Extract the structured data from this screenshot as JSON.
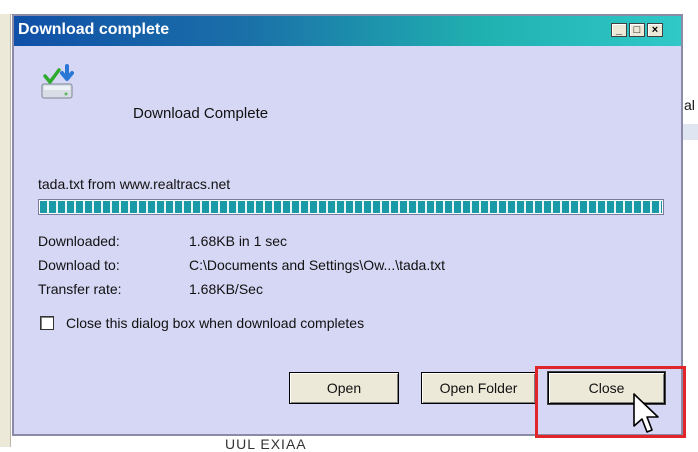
{
  "dialog": {
    "title": "Download complete",
    "header": "Download Complete",
    "file_line": "tada.txt from www.realtracs.net",
    "progress_fraction": 1.0,
    "info": [
      {
        "label": "Downloaded:",
        "value": "1.68KB in 1 sec"
      },
      {
        "label": "Download to:",
        "value": "C:\\Documents and Settings\\Ow...\\tada.txt"
      },
      {
        "label": "Transfer rate:",
        "value": "1.68KB/Sec"
      }
    ],
    "checkbox_label": "Close this dialog box when download completes",
    "checkbox_checked": false,
    "buttons": {
      "open": "Open",
      "open_folder": "Open Folder",
      "close": "Close"
    },
    "window_controls": {
      "minimize": "_",
      "maximize": "□",
      "close": "×"
    }
  },
  "background": {
    "right_fragment": "al",
    "bottom_fragment": "UUL EXIAA"
  },
  "colors": {
    "dialog_bg": "#d6d6f5",
    "title_start": "#1050a8",
    "title_end": "#30c8c8",
    "progress": "#1a9aa6",
    "highlight": "#e0262a"
  },
  "icons": [
    "download-complete-icon",
    "mouse-cursor-icon"
  ]
}
